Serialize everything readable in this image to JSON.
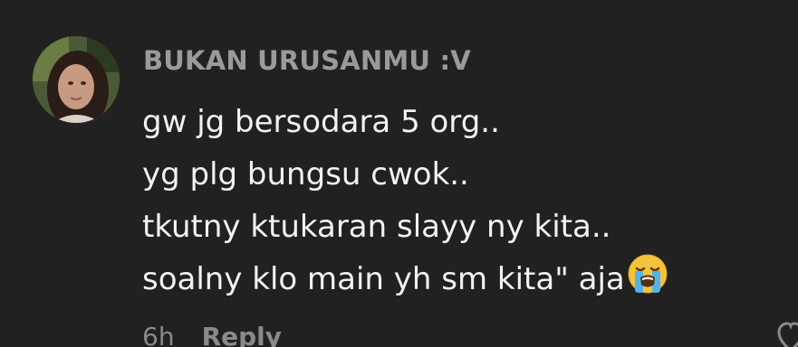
{
  "comment": {
    "username": "BUKAN URUSANMU :V",
    "lines": [
      "gw jg bersodara 5 org..",
      "yg plg bungsu cwok..",
      "tkutny ktukaran slayy ny kita..",
      "soalny klo main yh sm kita\" aja"
    ],
    "emoji": "loudly-crying-face",
    "time": "6h",
    "reply_label": "Reply"
  },
  "icons": {
    "like": "heart-outline-icon"
  }
}
